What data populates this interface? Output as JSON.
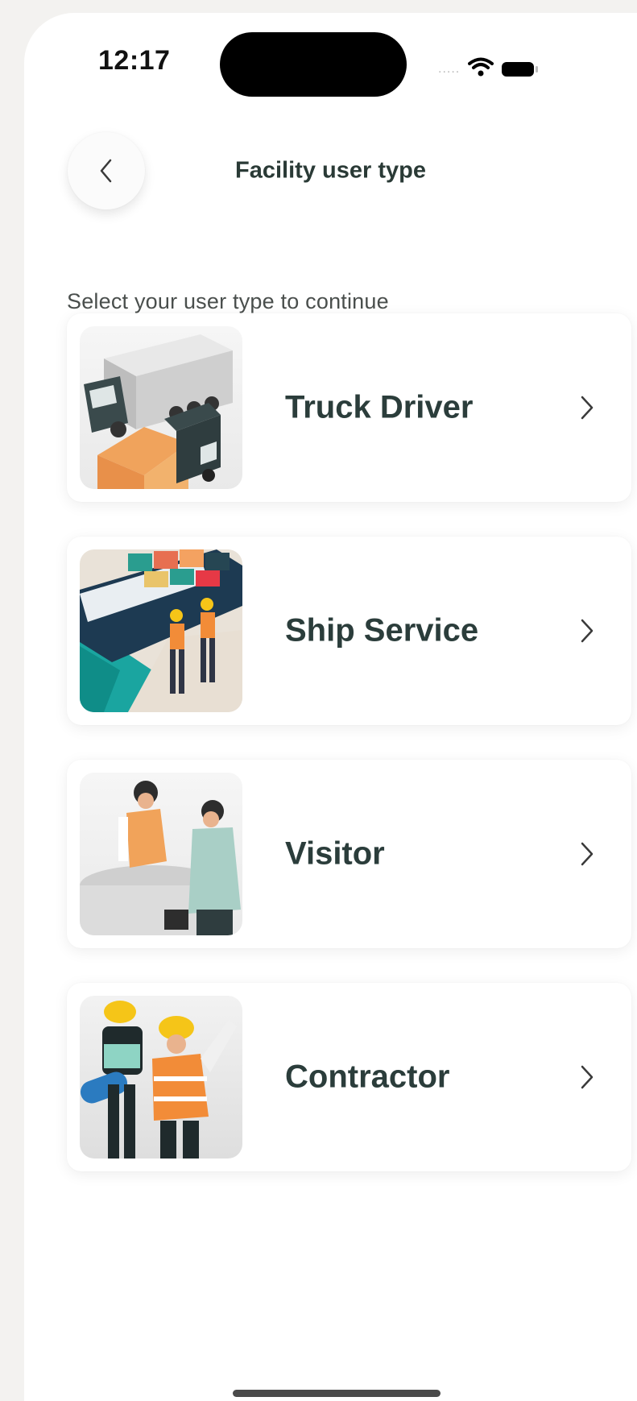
{
  "status_bar": {
    "time": "12:17",
    "signal_dots": "....."
  },
  "header": {
    "title": "Facility user type",
    "back_icon": "chevron-left-icon"
  },
  "subtitle": "Select your user type to continue",
  "options": [
    {
      "label": "Truck Driver",
      "icon": "truck-illustration"
    },
    {
      "label": "Ship Service",
      "icon": "ship-port-illustration"
    },
    {
      "label": "Visitor",
      "icon": "visitor-illustration"
    },
    {
      "label": "Contractor",
      "icon": "contractor-illustration"
    }
  ],
  "colors": {
    "text_primary": "#2b3d3b",
    "background": "#f3f2f0",
    "card": "#ffffff"
  }
}
